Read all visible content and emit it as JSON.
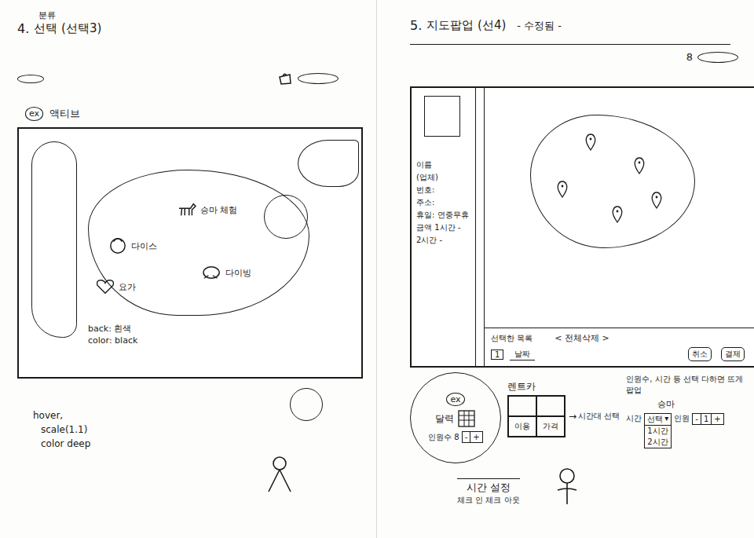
{
  "left": {
    "step": "4.",
    "insert": "분류",
    "title": "선택 (선택3)",
    "exBadge": "ex",
    "exLabel": "액티브",
    "activities": [
      {
        "label": "승마 체험",
        "kind": "horse"
      },
      {
        "label": "다이스",
        "kind": "dice"
      },
      {
        "label": "다이빙",
        "kind": "diving"
      },
      {
        "label": "요가",
        "kind": "yoga"
      }
    ],
    "mapNote": [
      "back: 흰색",
      "color: black"
    ],
    "hoverNote": [
      "hover,",
      "scale(1.1)",
      "color deep"
    ]
  },
  "right": {
    "step": "5.",
    "title": "지도팝업 (선4)",
    "status": "- 수정됨 -",
    "headerMark": "8",
    "info": [
      "이름",
      "(업체)",
      "번호:",
      "주소:",
      "휴일: 연중무휴",
      "금액 1시간 -",
      "2시간 -"
    ],
    "selection": {
      "title": "선택한 목록",
      "clear": "< 전체삭제 >",
      "count": "1",
      "date": "날짜",
      "buttons": [
        "취소",
        "결제"
      ]
    },
    "calendar": {
      "badge": "ex",
      "label": "달력",
      "people": "인원수",
      "count": "8",
      "minus": "-",
      "plus": "+"
    },
    "rental": {
      "label": "렌트카",
      "cells": [
        "이용",
        "가격"
      ],
      "arrow": "→",
      "arrowNote": "시간대 선택"
    },
    "popup": {
      "note": "인원수, 시간 등 선택 다하면 뜨게 팝업",
      "item": "승마",
      "timeLabel": "시간",
      "timeSelect": "선택",
      "caret": "▾",
      "timeOptions": [
        "1시간",
        "2시간"
      ],
      "peopleLabel": "인원",
      "minus": "-",
      "count": "1",
      "plus": "+"
    },
    "footer": {
      "title": "시간 설정",
      "sub": "체크 인 체크 아웃"
    }
  }
}
